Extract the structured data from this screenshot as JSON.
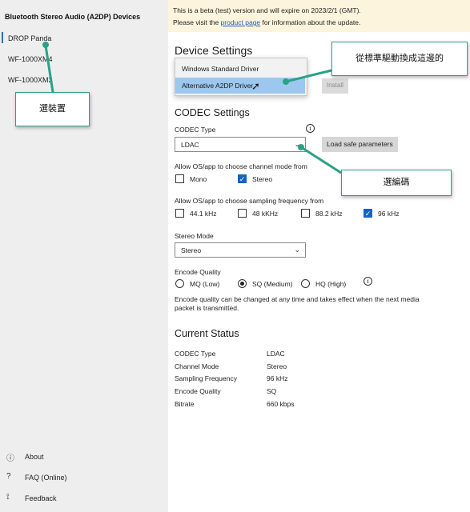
{
  "app": {
    "title": "Bluetooth Stereo Audio (A2DP) Devices"
  },
  "sidebar": {
    "devices": [
      "DROP Panda",
      "WF-1000XM4",
      "WF-1000XM3"
    ],
    "links": [
      {
        "label": "About",
        "icon": "info-icon"
      },
      {
        "label": "FAQ (Online)",
        "icon": "question-icon"
      },
      {
        "label": "Feedback",
        "icon": "feedback-icon"
      }
    ]
  },
  "banner": {
    "line1": "This is a beta (test) version and will expire on 2023/2/1 (GMT).",
    "line2_before": "Please visit the ",
    "line2_link": "product page",
    "line2_after": " for information about the update."
  },
  "device_settings": {
    "heading": "Device Settings",
    "driver_options": [
      "Windows Standard Driver",
      "Alternative A2DP Driver"
    ],
    "highlighted_option": "Alternative A2DP Driver",
    "install_label": "Install"
  },
  "codec_settings": {
    "heading": "CODEC Settings",
    "codec_type_label": "CODEC Type",
    "codec_type_value": "LDAC",
    "load_safe_label": "Load safe parameters",
    "channel_mode_label": "Allow OS/app to choose channel mode from",
    "channel_modes": [
      {
        "label": "Mono",
        "checked": false
      },
      {
        "label": "Stereo",
        "checked": true
      }
    ],
    "sampling_label": "Allow OS/app to choose sampling frequency from",
    "sampling_freqs": [
      {
        "label": "44.1 kHz",
        "checked": false
      },
      {
        "label": "48 kKHz",
        "checked": false
      },
      {
        "label": "88.2 kHz",
        "checked": false
      },
      {
        "label": "96 kHz",
        "checked": true
      }
    ],
    "stereo_mode_label": "Stereo Mode",
    "stereo_mode_value": "Stereo",
    "encode_quality_label": "Encode Quality",
    "encode_qualities": [
      {
        "label": "MQ (Low)",
        "selected": false
      },
      {
        "label": "SQ (Medium)",
        "selected": true
      },
      {
        "label": "HQ (High)",
        "selected": false
      }
    ],
    "encode_note_line1": "Encode quality can be changed at any time and takes effect when the next media",
    "encode_note_line2": "packet is transmitted."
  },
  "current_status": {
    "heading": "Current Status",
    "rows": [
      {
        "key": "CODEC Type",
        "value": "LDAC"
      },
      {
        "key": "Channel Mode",
        "value": "Stereo"
      },
      {
        "key": "Sampling Frequency",
        "value": "96 kHz"
      },
      {
        "key": "Encode Quality",
        "value": "SQ"
      },
      {
        "key": "Bitrate",
        "value": "660 kbps"
      }
    ]
  },
  "annotations": {
    "select_device": "選裝置",
    "driver_note": "從標準驅動換成這邊的",
    "select_codec": "選編碼",
    "accent_color": "#2aa287"
  },
  "colors": {
    "accent": "#1463c4",
    "banner_bg": "#fcf4dd",
    "sidebar_bg": "#eeeeee"
  }
}
